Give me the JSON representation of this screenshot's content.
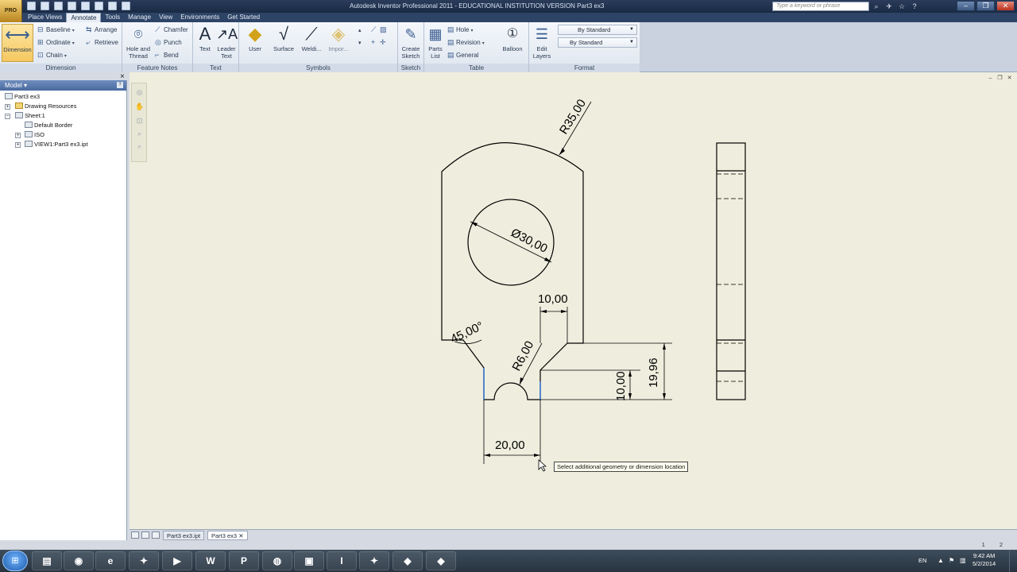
{
  "window": {
    "title": "Autodesk Inventor Professional 2011 - EDUCATIONAL INSTITUTION VERSION    Part3 ex3",
    "app_button": "PRO",
    "search_placeholder": "Type a keyword or phrase",
    "controls": [
      "–",
      "❐",
      "✕"
    ]
  },
  "ribbon_tabs": [
    {
      "label": "Place Views",
      "active": false
    },
    {
      "label": "Annotate",
      "active": true
    },
    {
      "label": "Tools",
      "active": false
    },
    {
      "label": "Manage",
      "active": false
    },
    {
      "label": "View",
      "active": false
    },
    {
      "label": "Environments",
      "active": false
    },
    {
      "label": "Get Started",
      "active": false
    }
  ],
  "ribbon": {
    "dimension": {
      "title": "Dimension",
      "big": "Dimension",
      "baseline": "Baseline",
      "ordinate": "Ordinate",
      "chain": "Chain",
      "arrange": "Arrange",
      "retrieve": "Retrieve"
    },
    "feature_notes": {
      "title": "Feature Notes",
      "hole_thread_1": "Hole and",
      "hole_thread_2": "Thread",
      "chamfer": "Chamfer",
      "punch": "Punch",
      "bend": "Bend"
    },
    "text": {
      "title": "Text",
      "text": "Text",
      "leader_1": "Leader",
      "leader_2": "Text"
    },
    "symbols": {
      "title": "Symbols",
      "user": "User",
      "surface": "Surface",
      "welding": "Weldi...",
      "import": "Impor..."
    },
    "sketch": {
      "title": "Sketch",
      "create_1": "Create",
      "create_2": "Sketch"
    },
    "table": {
      "title": "Table",
      "parts_1": "Parts",
      "parts_2": "List",
      "hole": "Hole",
      "revision": "Revision",
      "general": "General",
      "balloon": "Balloon"
    },
    "format": {
      "title": "Format",
      "edit_1": "Edit",
      "edit_2": "Layers",
      "style": "By Standard",
      "layer": "By Standard"
    }
  },
  "browser": {
    "header": "Model",
    "items": [
      {
        "label": "Part3 ex3",
        "icon": "drawing-icon"
      },
      {
        "label": "Drawing Resources",
        "icon": "folder-icon"
      },
      {
        "label": "Sheet:1",
        "icon": "sheet-icon"
      },
      {
        "label": "Default Border",
        "icon": "border-icon"
      },
      {
        "label": "ISO",
        "icon": "title-block-icon"
      },
      {
        "label": "VIEW1:Part3 ex3.ipt",
        "icon": "view-icon"
      }
    ]
  },
  "drawing": {
    "dim_radius_outer": "R35,00",
    "dim_diameter": "Ø30,00",
    "dim_slot_top": "10,00",
    "dim_chamfer_angle": "45,00°",
    "dim_notch_radius": "R6,00",
    "dim_bottom_width": "20,00",
    "dim_height_small": "10,00",
    "dim_height_total": "19,96"
  },
  "tooltip": "Select additional geometry or dimension location",
  "doc_tabs": [
    {
      "label": "Part3 ex3.ipt",
      "active": false
    },
    {
      "label": "Part3 ex3",
      "active": true
    }
  ],
  "status": {
    "sheet_numbers": [
      "1",
      "2"
    ]
  },
  "taskbar": {
    "apps": [
      {
        "name": "explorer",
        "glyph": "▤"
      },
      {
        "name": "chrome",
        "glyph": "◉"
      },
      {
        "name": "internet-explorer",
        "glyph": "e"
      },
      {
        "name": "app-generic-1",
        "glyph": "✦"
      },
      {
        "name": "media",
        "glyph": "▶"
      },
      {
        "name": "word",
        "glyph": "W"
      },
      {
        "name": "powerpoint",
        "glyph": "P"
      },
      {
        "name": "app-generic-2",
        "glyph": "◍"
      },
      {
        "name": "app-generic-3",
        "glyph": "▣"
      },
      {
        "name": "inventor",
        "glyph": "I"
      },
      {
        "name": "app-generic-4",
        "glyph": "✦"
      },
      {
        "name": "app-generic-5",
        "glyph": "◆"
      },
      {
        "name": "app-generic-6",
        "glyph": "◆"
      }
    ],
    "language": "EN",
    "time": "9:42 AM",
    "date": "5/2/2014"
  }
}
